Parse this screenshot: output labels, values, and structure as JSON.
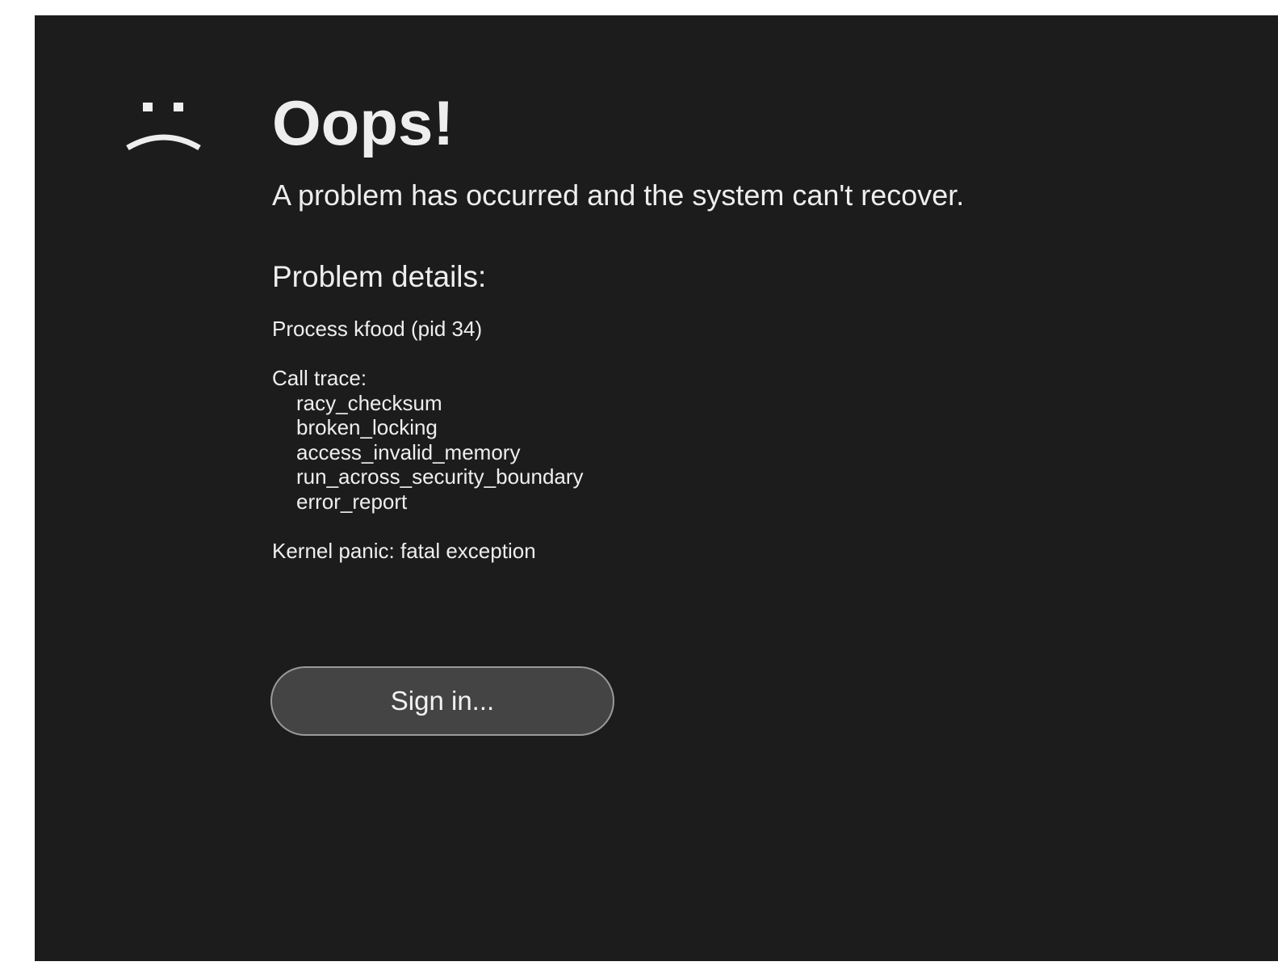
{
  "error": {
    "icon": "sad-face-icon",
    "title": "Oops!",
    "message": "A problem has occurred and the system can't recover.",
    "details_heading": "Problem details:",
    "process_line": "Process kfood (pid 34)",
    "call_trace_label": "Call trace:",
    "call_trace": [
      "racy_checksum",
      "broken_locking",
      "access_invalid_memory",
      "run_across_security_boundary",
      "error_report"
    ],
    "panic_line": "Kernel panic: fatal exception"
  },
  "actions": {
    "signin_label": "Sign in..."
  },
  "colors": {
    "background": "#1c1c1c",
    "text": "#eeeeee",
    "button_fill": "#444444",
    "button_border": "#9a9a9a"
  }
}
